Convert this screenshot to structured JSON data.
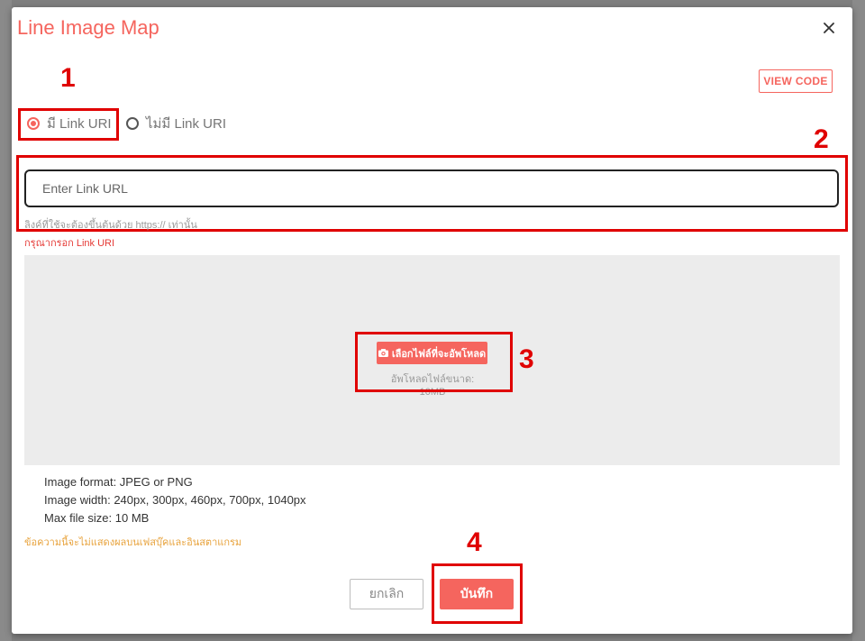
{
  "modal": {
    "title": "Line Image Map",
    "view_code_label": "VIEW CODE"
  },
  "annotations": [
    "1",
    "2",
    "3",
    "4"
  ],
  "link_options": {
    "with_link_label": "มี Link URI",
    "without_link_label": "ไม่มี Link URI",
    "selected": "with_link"
  },
  "url_field": {
    "placeholder": "Enter Link URL",
    "value": "",
    "helper": "ลิงค์ที่ใช้จะต้องขึ้นต้นด้วย https:// เท่านั้น",
    "error": "กรุณากรอก Link URI"
  },
  "upload": {
    "button_label": "เลือกไฟล์ที่จะอัพโหลด",
    "size_note": "อัพโหลดไฟล์ขนาด: 10MB",
    "icon": "camera-icon"
  },
  "specs": [
    "Image format: JPEG or PNG",
    "Image width: 240px, 300px, 460px, 700px, 1040px",
    "Max file size: 10 MB"
  ],
  "warning": "ข้อความนี้จะไม่แสดงผลบนเฟสบุ๊คและอินสตาแกรม",
  "footer": {
    "cancel_label": "ยกเลิก",
    "save_label": "บันทึก"
  },
  "colors": {
    "accent": "#f5655e",
    "annotation": "#e00000",
    "error": "#e53935",
    "warning": "#e8a33d"
  }
}
